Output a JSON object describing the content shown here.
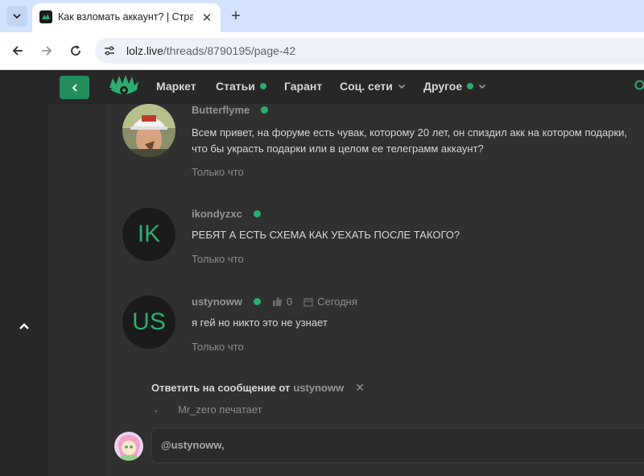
{
  "browser": {
    "tab_title": "Как взломать аккаунт? | Стран",
    "url_host": "lolz.live",
    "url_path": "/threads/8790195/page-42"
  },
  "header": {
    "nav": [
      {
        "label": "Маркет",
        "dot": false,
        "dropdown": false
      },
      {
        "label": "Статьи",
        "dot": true,
        "dropdown": false
      },
      {
        "label": "Гарант",
        "dot": false,
        "dropdown": false
      },
      {
        "label": "Соц. сети",
        "dot": false,
        "dropdown": true
      },
      {
        "label": "Другое",
        "dot": true,
        "dropdown": true
      }
    ]
  },
  "posts": [
    {
      "author": "Butterflyme",
      "avatar": "photo",
      "lines": [
        "Всем привет, на форуме есть чувак, которому 20 лет, он спиздил акк на котором подарки,",
        "что бы украсть подарки или в целом ее телеграмм аккаунт?"
      ],
      "time": "Только что"
    },
    {
      "author": "ikondyzxc",
      "avatar": "IK",
      "lines": [
        "РЕБЯТ А ЕСТЬ СХЕМА КАК УЕХАТЬ ПОСЛЕ ТАКОГО?"
      ],
      "time": "Только что"
    },
    {
      "author": "ustynoww",
      "avatar": "US",
      "likes": "0",
      "date": "Сегодня",
      "lines": [
        "я гей но никто это не узнает"
      ],
      "time": "Только что"
    }
  ],
  "reply": {
    "prefix": "Ответить на сообщение от",
    "user": "ustynoww",
    "typing": "Mr_zero печатает",
    "editor_text": "@ustynoww,"
  },
  "colors": {
    "accent": "#2bad72",
    "button": "#228e5d",
    "background": "#272727",
    "panel": "#303030"
  }
}
